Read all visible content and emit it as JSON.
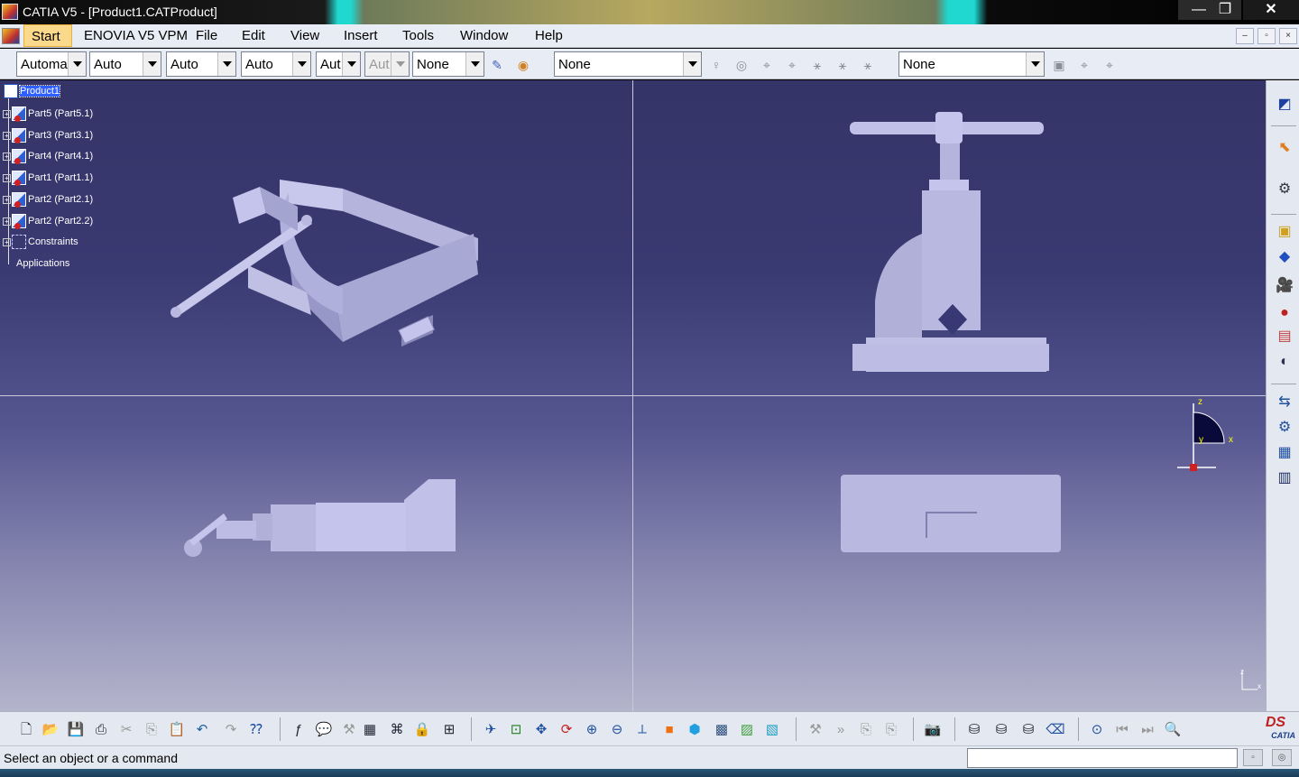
{
  "window": {
    "title": "CATIA V5 - [Product1.CATProduct]",
    "min": "—",
    "max": "❐",
    "close": "✕"
  },
  "menu": {
    "start": "Start",
    "items": [
      "ENOVIA V5 VPM",
      "File",
      "Edit",
      "View",
      "Insert",
      "Tools",
      "Window",
      "Help"
    ],
    "mdi_min": "–",
    "mdi_restore": "▫",
    "mdi_close": "×"
  },
  "toolbar": {
    "combos": [
      "Automatic",
      "Auto",
      "Auto",
      "Auto",
      "Aut",
      "Aut",
      "None"
    ],
    "layer_filter": "None",
    "layer": "None"
  },
  "tree": {
    "root": "Product1",
    "children": [
      "Part5 (Part5.1)",
      "Part3 (Part3.1)",
      "Part4 (Part4.1)",
      "Part1 (Part1.1)",
      "Part2 (Part2.1)",
      "Part2 (Part2.2)"
    ],
    "constraints": "Constraints",
    "applications": "Applications"
  },
  "compass": {
    "z": "z",
    "x": "x",
    "y": "y"
  },
  "axis_triad": {
    "z": "z",
    "x": "x"
  },
  "status": {
    "message": "Select an object or a command"
  },
  "logo": {
    "ds": "DS",
    "name": "CATIA"
  },
  "colors": {
    "viewport_top": "#343468",
    "viewport_bottom": "#b4b4cc",
    "part": "#b8b8e0",
    "menu_start_bg": "#fbd98a"
  }
}
